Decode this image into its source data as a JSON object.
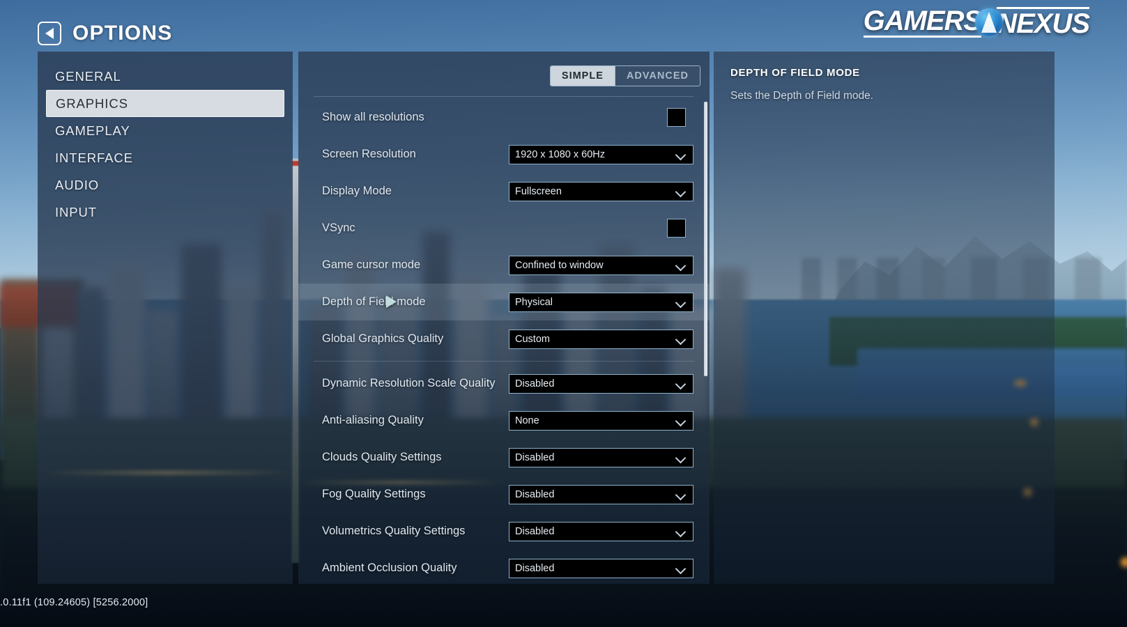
{
  "header": {
    "title": "OPTIONS",
    "back_icon": "back-triangle-icon"
  },
  "branding": {
    "word_left": "GAMERS",
    "word_right": "NEXUS",
    "emblem_icon": "gn-globe-emblem-icon"
  },
  "sidebar": {
    "items": [
      {
        "label": "GENERAL",
        "active": false
      },
      {
        "label": "GRAPHICS",
        "active": true
      },
      {
        "label": "GAMEPLAY",
        "active": false
      },
      {
        "label": "INTERFACE",
        "active": false
      },
      {
        "label": "AUDIO",
        "active": false
      },
      {
        "label": "INPUT",
        "active": false
      }
    ]
  },
  "main": {
    "tabs": [
      {
        "label": "SIMPLE",
        "active": true
      },
      {
        "label": "ADVANCED",
        "active": false
      }
    ],
    "settings": [
      {
        "label": "Show all resolutions",
        "type": "checkbox",
        "checked": false
      },
      {
        "label": "Screen Resolution",
        "type": "dropdown",
        "value": "1920 x 1080 x 60Hz"
      },
      {
        "label": "Display Mode",
        "type": "dropdown",
        "value": "Fullscreen"
      },
      {
        "label": "VSync",
        "type": "checkbox",
        "checked": false
      },
      {
        "label": "Game cursor mode",
        "type": "dropdown",
        "value": "Confined to window"
      },
      {
        "label": "Depth of Field mode",
        "type": "dropdown",
        "value": "Physical",
        "highlighted": true
      },
      {
        "label": "Global Graphics Quality",
        "type": "dropdown",
        "value": "Custom"
      },
      {
        "label": "Dynamic Resolution Scale Quality",
        "type": "dropdown",
        "value": "Disabled",
        "separator_before": true
      },
      {
        "label": "Anti-aliasing Quality",
        "type": "dropdown",
        "value": "None"
      },
      {
        "label": "Clouds Quality Settings",
        "type": "dropdown",
        "value": "Disabled"
      },
      {
        "label": "Fog Quality Settings",
        "type": "dropdown",
        "value": "Disabled"
      },
      {
        "label": "Volumetrics Quality Settings",
        "type": "dropdown",
        "value": "Disabled"
      },
      {
        "label": "Ambient Occlusion Quality",
        "type": "dropdown",
        "value": "Disabled"
      }
    ]
  },
  "info_panel": {
    "title": "DEPTH OF FIELD MODE",
    "description": "Sets the Depth of Field mode."
  },
  "status_bar": {
    "text": ".0.11f1 (109.24605) [5256.2000]"
  },
  "colors": {
    "accent_selected": "#d7dce2",
    "control_border": "#8fb3cc",
    "control_bg": "#000000",
    "panel_bg": "#2e425c",
    "text_primary": "#e9eef4",
    "emblem_blue": "#2d8fd4"
  }
}
